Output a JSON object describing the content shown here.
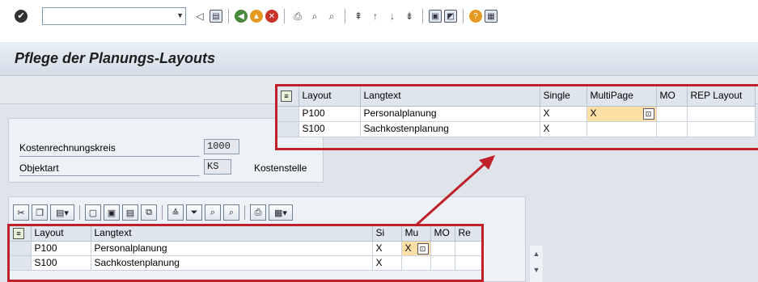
{
  "title": "Pflege der Planungs-Layouts",
  "toolbar": {
    "command_field": "",
    "icons": [
      "back-icon",
      "save-icon",
      "green-arrow-icon",
      "up-icon",
      "cancel-icon",
      "print-icon",
      "find-icon",
      "find-next-icon",
      "first-page-icon",
      "prev-page-icon",
      "next-page-icon",
      "last-page-icon",
      "new-session-icon",
      "shortcut-icon",
      "help-icon",
      "customize-icon"
    ]
  },
  "form": {
    "kostenrechnungskreis_label": "Kostenrechnungskreis",
    "kostenrechnungskreis_value": "1000",
    "objektart_label": "Objektart",
    "objektart_value": "KS",
    "objektart_text": "Kostenstelle"
  },
  "upper_grid": {
    "headers": [
      "Layout",
      "Langtext",
      "Single",
      "MultiPage",
      "MO",
      "REP Layout"
    ],
    "rows": [
      {
        "layout": "P100",
        "langtext": "Personalplanung",
        "single": "X",
        "multipage": "X",
        "mo": "",
        "rep": ""
      },
      {
        "layout": "S100",
        "langtext": "Sachkostenplanung",
        "single": "X",
        "multipage": "",
        "mo": "",
        "rep": ""
      }
    ]
  },
  "lower_grid": {
    "headers": [
      "Layout",
      "Langtext",
      "Single",
      "MultiPage",
      "MO",
      "REP Layout"
    ],
    "header_display": [
      "Layout",
      "Langtext",
      "Si",
      "Mu",
      "MO",
      "Re"
    ],
    "rows": [
      {
        "layout": "P100",
        "langtext": "Personalplanung",
        "single": "X",
        "multipage": "X",
        "mo": "",
        "rep": ""
      },
      {
        "layout": "S100",
        "langtext": "Sachkostenplanung",
        "single": "X",
        "multipage": "",
        "mo": "",
        "rep": ""
      }
    ]
  },
  "colors": {
    "highlight_border": "#c0202a",
    "selected_cell": "#fde0a6"
  }
}
